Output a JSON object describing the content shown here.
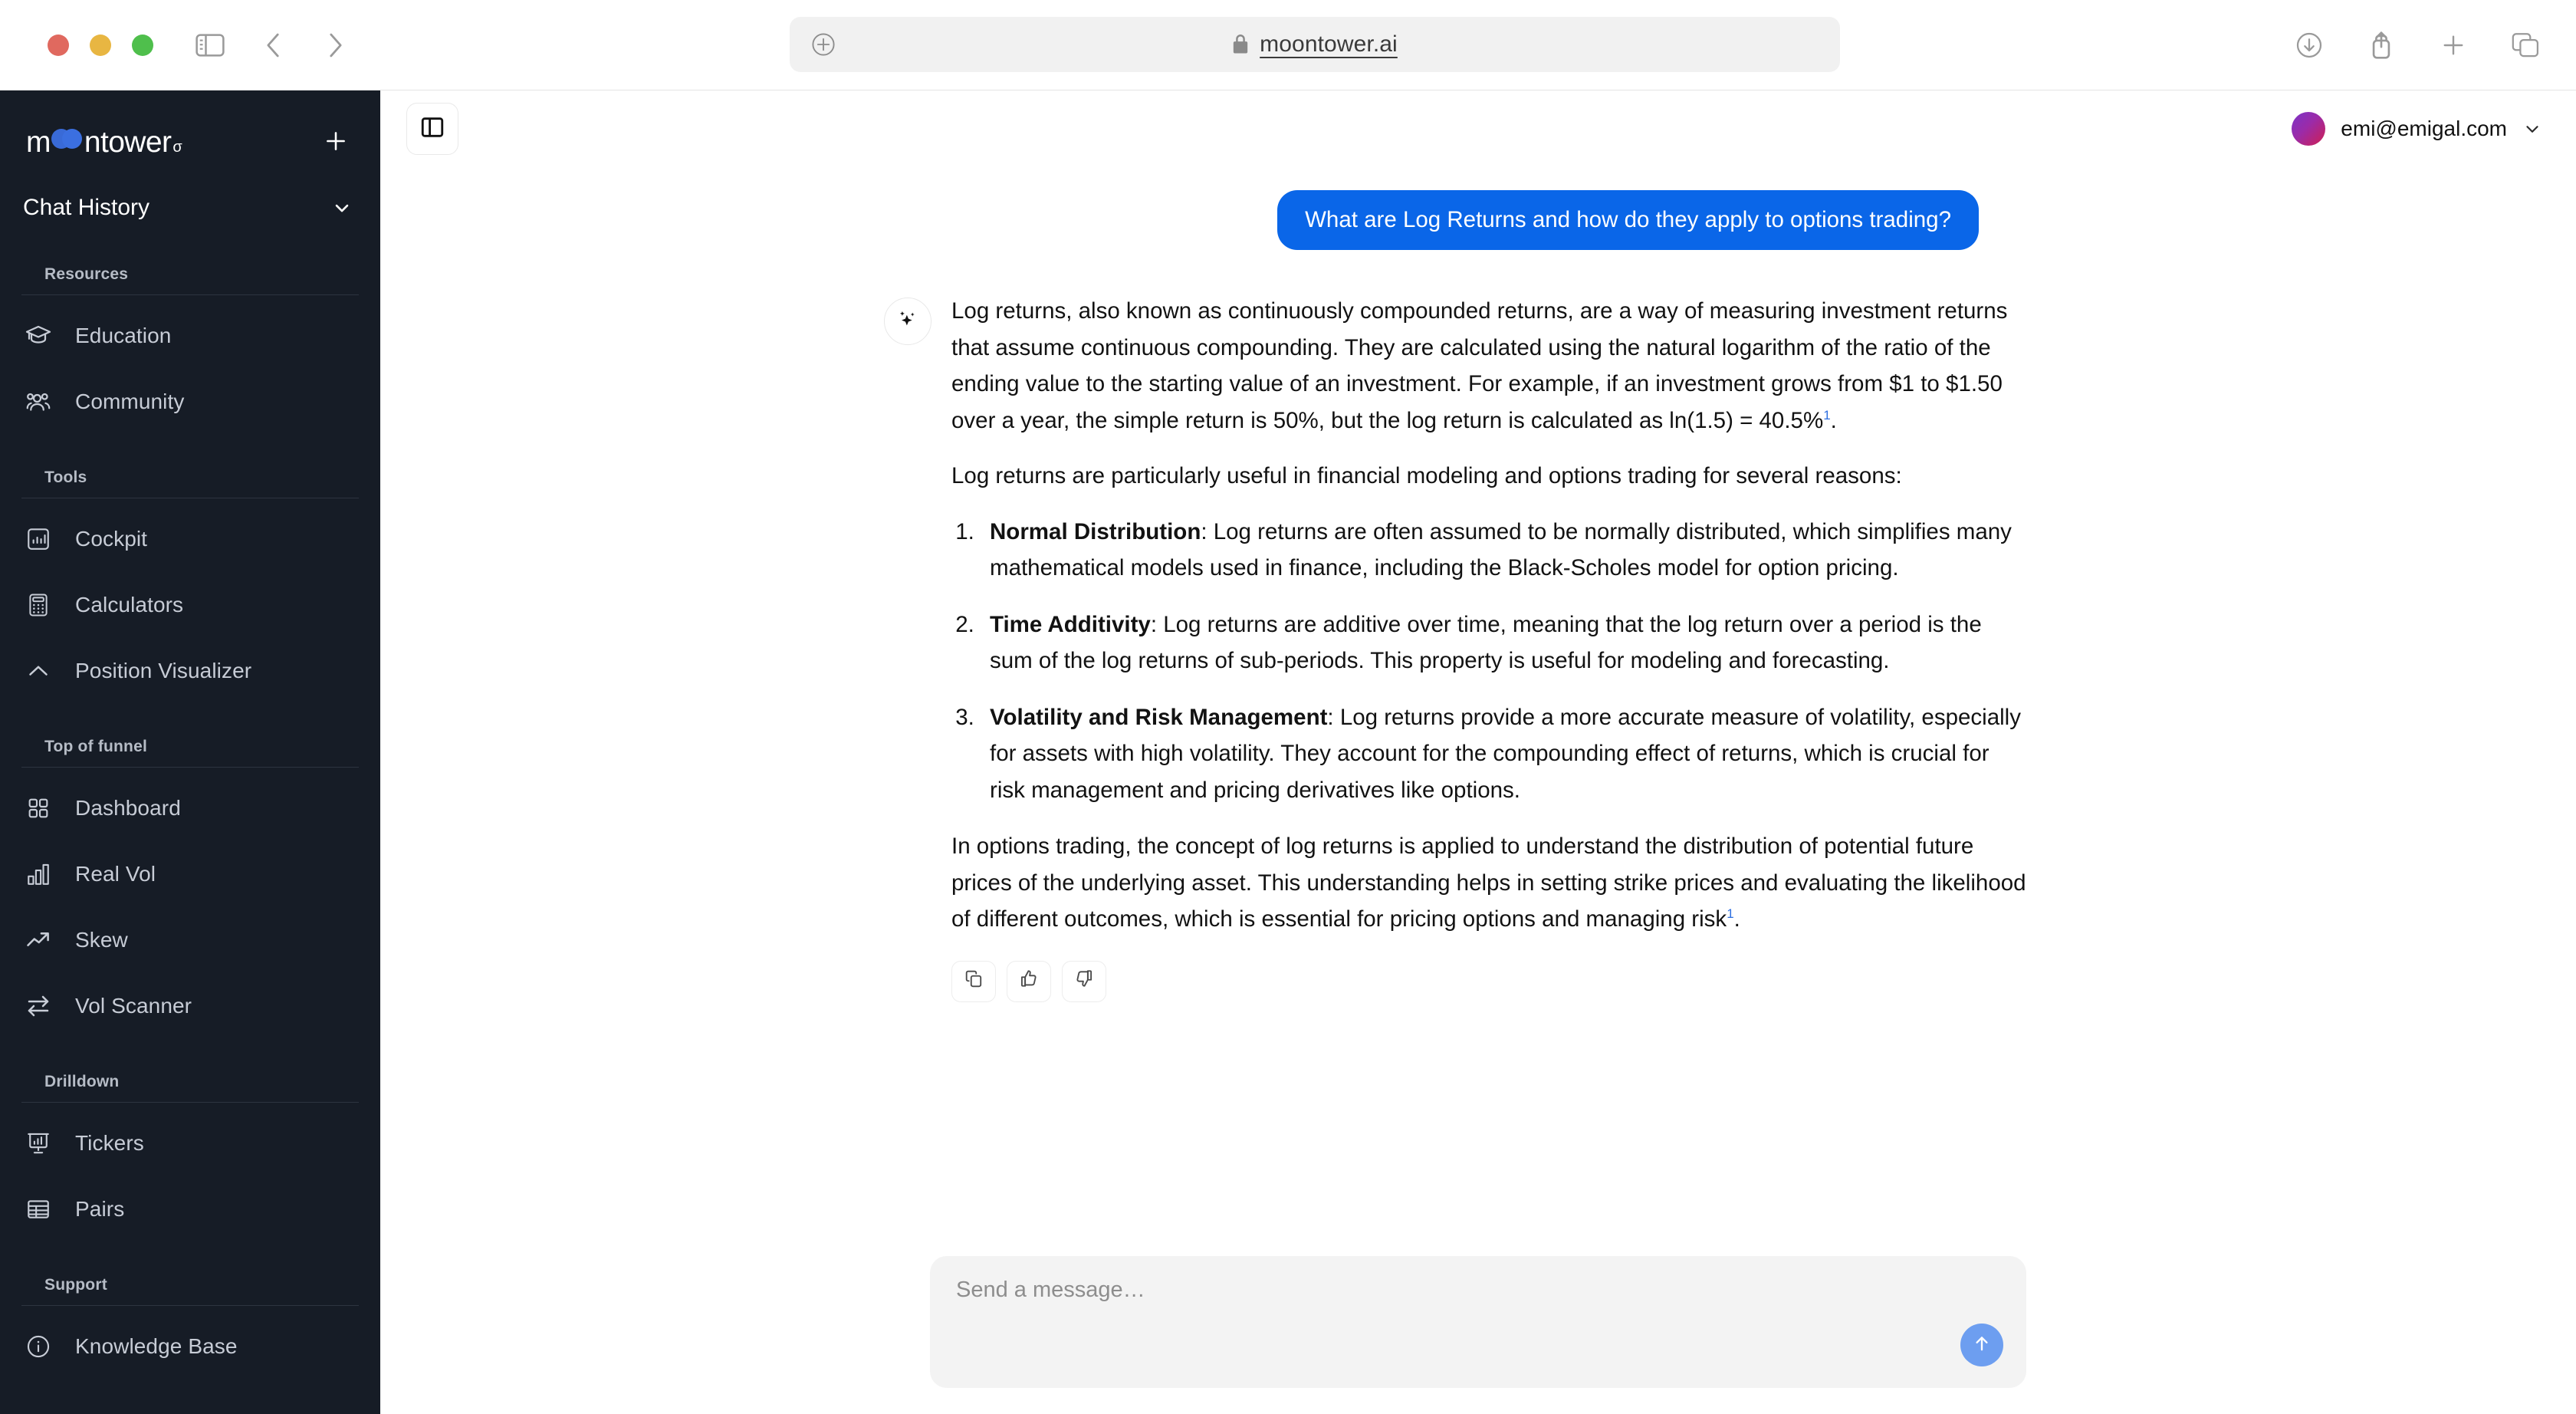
{
  "browser": {
    "url": "moontower.ai",
    "lock_icon": "lock-icon",
    "add_icon": "plus-circle-icon",
    "back_icon": "chevron-left-icon",
    "forward_icon": "chevron-right-icon",
    "sidebar_toggle_icon": "sidebar-icon",
    "downloads_icon": "download-icon",
    "share_icon": "share-icon",
    "new_tab_icon": "plus-icon",
    "tab_overview_icon": "tabs-icon",
    "traffic_lights": {
      "close": "#e0695f",
      "minimize": "#e8b642",
      "maximize": "#4fbf4c"
    }
  },
  "sidebar": {
    "logo": {
      "before": "m",
      "middle": "oo",
      "after": "ntower",
      "superscript": "σ"
    },
    "new_chat_icon": "plus-icon",
    "chat_history": {
      "label": "Chat History",
      "chevron_icon": "chevron-down-icon"
    },
    "sections": [
      {
        "title": "Resources",
        "items": [
          {
            "label": "Education",
            "icon": "graduation-cap-icon"
          },
          {
            "label": "Community",
            "icon": "users-icon"
          }
        ]
      },
      {
        "title": "Tools",
        "items": [
          {
            "label": "Cockpit",
            "icon": "bar-chart-box-icon"
          },
          {
            "label": "Calculators",
            "icon": "calculator-icon"
          },
          {
            "label": "Position Visualizer",
            "icon": "chevron-up-icon"
          }
        ]
      },
      {
        "title": "Top of funnel",
        "items": [
          {
            "label": "Dashboard",
            "icon": "grid-icon"
          },
          {
            "label": "Real Vol",
            "icon": "bar-chart-icon"
          },
          {
            "label": "Skew",
            "icon": "trending-up-icon"
          },
          {
            "label": "Vol Scanner",
            "icon": "exchange-arrows-icon"
          }
        ]
      },
      {
        "title": "Drilldown",
        "items": [
          {
            "label": "Tickers",
            "icon": "presentation-chart-icon"
          },
          {
            "label": "Pairs",
            "icon": "table-icon"
          }
        ]
      },
      {
        "title": "Support",
        "items": [
          {
            "label": "Knowledge Base",
            "icon": "info-circle-icon"
          }
        ]
      }
    ]
  },
  "app_header": {
    "panel_toggle_icon": "panel-left-icon",
    "user_email": "emi@emigal.com",
    "user_chevron_icon": "chevron-down-icon"
  },
  "chat": {
    "user_message": "What are Log Returns and how do they apply to options trading?",
    "assistant": {
      "avatar_icon": "sparkles-icon",
      "p1_a": "Log returns, also known as continuously compounded returns, are a way of measuring investment returns that assume continuous compounding. They are calculated using the natural logarithm of the ratio of the ending value to the starting value of an investment. For example, if an investment grows from $1 to $1.50 over a year, the simple return is 50%, but the log return is calculated as ln(1.5) = 40.5%",
      "p1_cite": "1",
      "p1_b": ".",
      "p2": "Log returns are particularly useful in financial modeling and options trading for several reasons:",
      "list": [
        {
          "term": "Normal Distribution",
          "text": ": Log returns are often assumed to be normally distributed, which simplifies many mathematical models used in finance, including the Black-Scholes model for option pricing."
        },
        {
          "term": "Time Additivity",
          "text": ": Log returns are additive over time, meaning that the log return over a period is the sum of the log returns of sub-periods. This property is useful for modeling and forecasting."
        },
        {
          "term": "Volatility and Risk Management",
          "text": ": Log returns provide a more accurate measure of volatility, especially for assets with high volatility. They account for the compounding effect of returns, which is crucial for risk management and pricing derivatives like options."
        }
      ],
      "p3_a": "In options trading, the concept of log returns is applied to understand the distribution of potential future prices of the underlying asset. This understanding helps in setting strike prices and evaluating the likelihood of different outcomes, which is essential for pricing options and managing risk",
      "p3_cite": "1",
      "p3_b": ".",
      "actions": [
        {
          "name": "copy",
          "icon": "copy-icon"
        },
        {
          "name": "thumbs-up",
          "icon": "thumbs-up-icon"
        },
        {
          "name": "thumbs-down",
          "icon": "thumbs-down-icon"
        }
      ]
    }
  },
  "composer": {
    "placeholder": "Send a message…",
    "value": "",
    "send_icon": "arrow-up-icon"
  },
  "colors": {
    "sidebar_bg": "#161c26",
    "user_bubble": "#0a66e8",
    "citation": "#2e6fe0",
    "send_button": "#6d9ef0",
    "logo_accent": "#3b6fe0"
  }
}
